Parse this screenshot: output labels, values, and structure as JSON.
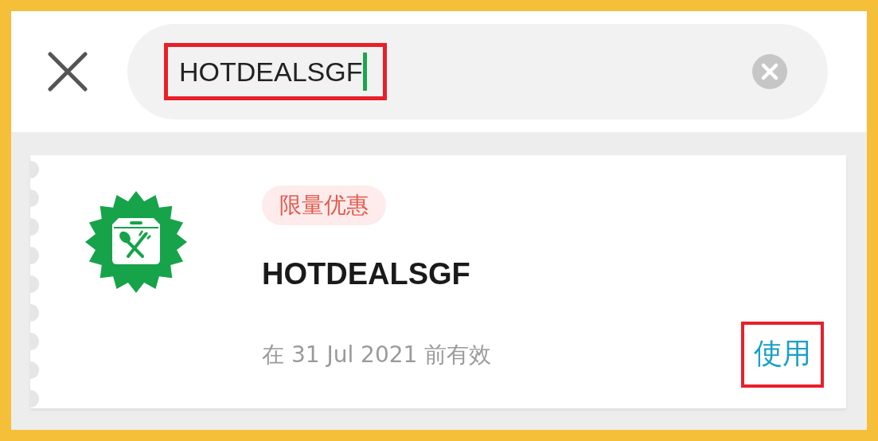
{
  "search": {
    "value": "HOTDEALSGF",
    "highlighted": true,
    "focused": true
  },
  "voucher": {
    "badge": "限量优惠",
    "code": "HOTDEALSGF",
    "validity": "在 31 Jul 2021 前有效",
    "action": "使用",
    "action_highlighted": true
  }
}
